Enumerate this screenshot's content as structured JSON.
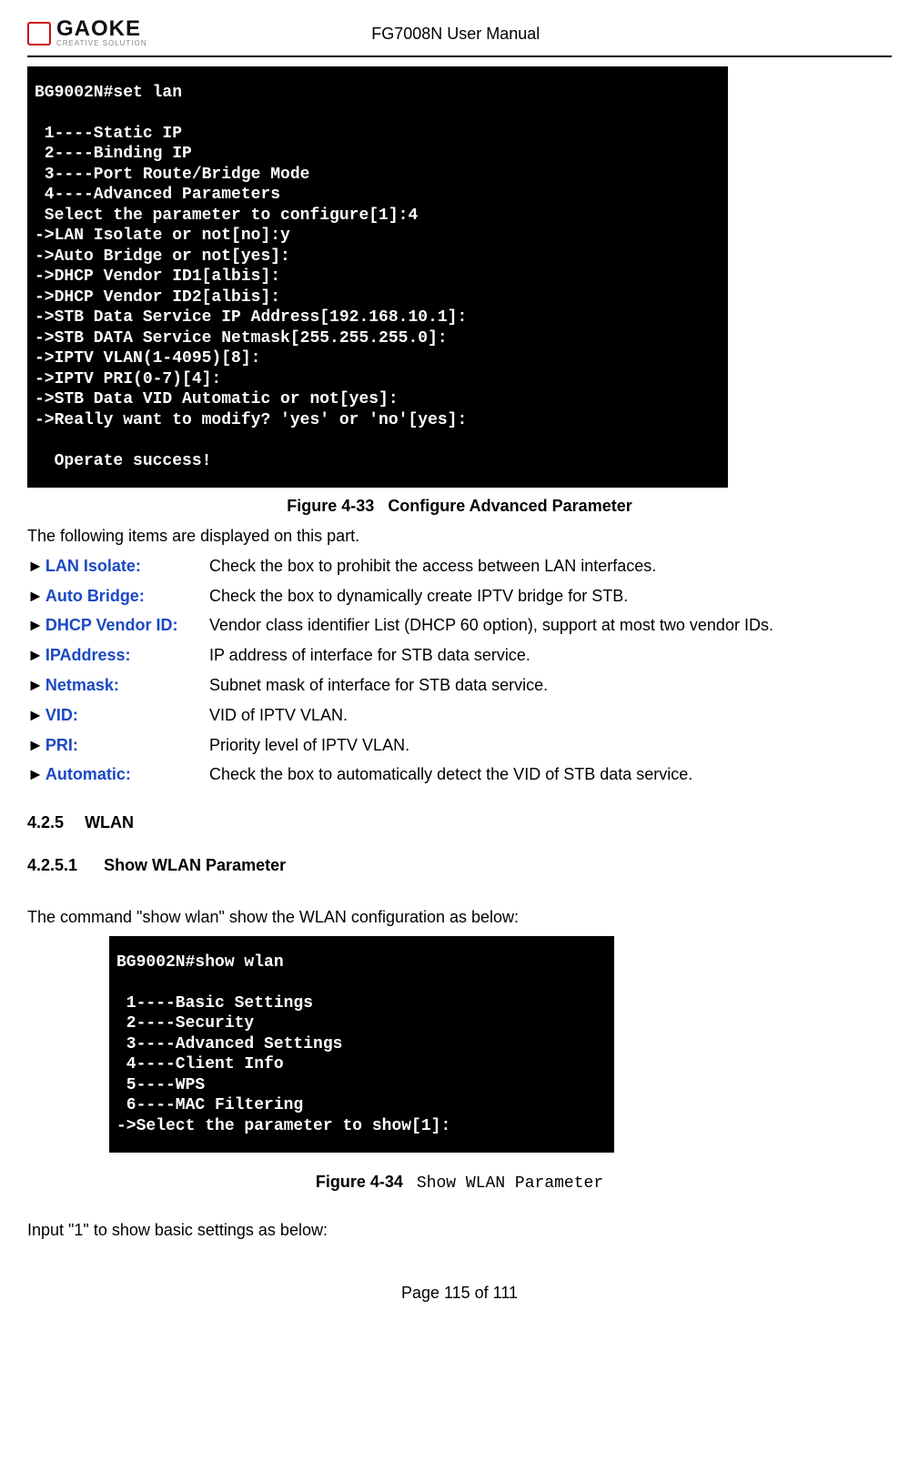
{
  "header": {
    "logo_name": "GAOKE",
    "logo_tag": "CREATIVE SOLUTION",
    "title": "FG7008N User Manual"
  },
  "terminal1_lines": [
    "BG9002N#set lan",
    "",
    " 1----Static IP",
    " 2----Binding IP",
    " 3----Port Route/Bridge Mode",
    " 4----Advanced Parameters",
    " Select the parameter to configure[1]:4",
    "->LAN Isolate or not[no]:y",
    "->Auto Bridge or not[yes]:",
    "->DHCP Vendor ID1[albis]:",
    "->DHCP Vendor ID2[albis]:",
    "->STB Data Service IP Address[192.168.10.1]:",
    "->STB DATA Service Netmask[255.255.255.0]:",
    "->IPTV VLAN(1-4095)[8]:",
    "->IPTV PRI(0-7)[4]:",
    "->STB Data VID Automatic or not[yes]:",
    "->Really want to modify? 'yes' or 'no'[yes]:",
    "",
    "  Operate success!"
  ],
  "figure1": {
    "num": "Figure 4-33",
    "title": "Configure Advanced Parameter"
  },
  "intro1": "The following items are displayed on this part.",
  "params": [
    {
      "marker": "►",
      "name": "LAN Isolate:",
      "desc": "Check the box to prohibit the access between LAN interfaces."
    },
    {
      "marker": "►",
      "name": "Auto Bridge:",
      "desc": "Check the box to dynamically create IPTV bridge for STB."
    },
    {
      "marker": "►",
      "name": "DHCP Vendor ID:",
      "desc": "Vendor class identifier List (DHCP 60 option), support at most two vendor IDs."
    },
    {
      "marker": "►",
      "name": "IPAddress:",
      "desc": "IP address of interface for STB data service."
    },
    {
      "marker": "►",
      "name": "Netmask:",
      "desc": "Subnet mask of interface for STB data service."
    },
    {
      "marker": "►",
      "name": "VID:",
      "desc": "VID of IPTV VLAN."
    },
    {
      "marker": "►",
      "name": "PRI:",
      "desc": "Priority level of IPTV VLAN."
    },
    {
      "marker": "►",
      "name": "Automatic:",
      "desc": "Check the box to automatically detect the VID of STB data service."
    }
  ],
  "section": {
    "num": "4.2.5",
    "title": "WLAN"
  },
  "subsection": {
    "num": "4.2.5.1",
    "title": "Show WLAN Parameter"
  },
  "intro2": "The command \"show wlan\" show the WLAN configuration as below:",
  "terminal2_lines": [
    "BG9002N#show wlan",
    "",
    " 1----Basic Settings",
    " 2----Security",
    " 3----Advanced Settings",
    " 4----Client Info",
    " 5----WPS",
    " 6----MAC Filtering",
    "->Select the parameter to show[1]:"
  ],
  "figure2": {
    "num": "Figure 4-34",
    "title": "Show WLAN Parameter"
  },
  "intro3": "Input \"1\" to show basic settings as below:",
  "footer": "Page 115 of 111"
}
